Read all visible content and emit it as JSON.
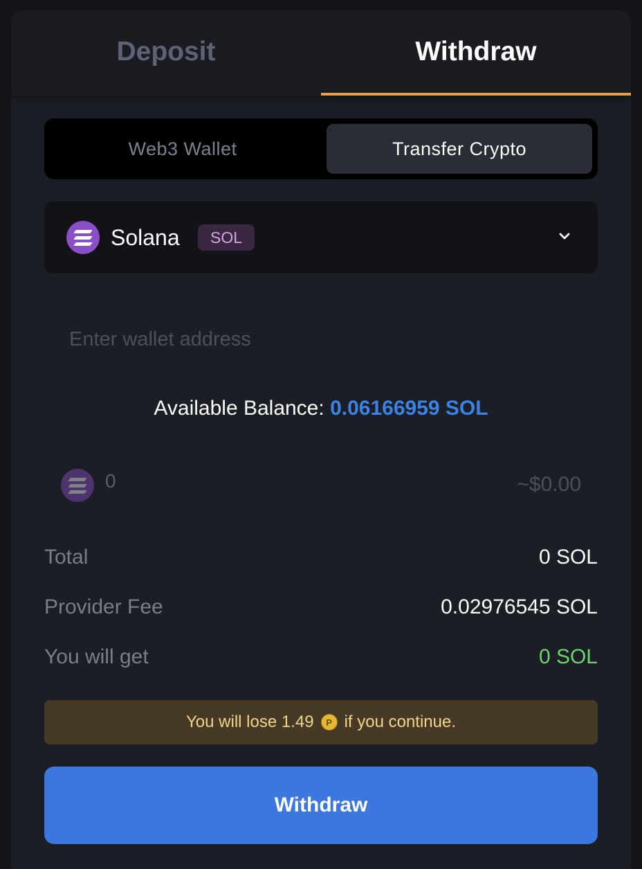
{
  "tabs": {
    "deposit_label": "Deposit",
    "withdraw_label": "Withdraw"
  },
  "method": {
    "web3_label": "Web3 Wallet",
    "transfer_label": "Transfer Crypto"
  },
  "coin": {
    "name": "Solana",
    "symbol": "SOL",
    "icon": "solana-icon",
    "dropdown_icon": "chevron-down-icon"
  },
  "address": {
    "value": "",
    "placeholder": "Enter wallet address"
  },
  "balance": {
    "label": "Available Balance:",
    "value": "0.06166959 SOL"
  },
  "amount": {
    "value": "0",
    "usd": "~$0.00"
  },
  "summary": {
    "total_label": "Total",
    "total_value": "0 SOL",
    "fee_label": "Provider Fee",
    "fee_value": "0.02976545 SOL",
    "get_label": "You will get",
    "get_value": "0 SOL"
  },
  "warning": {
    "prefix": "You will lose 1.49",
    "coin_icon": "points-coin-icon",
    "suffix": "if you continue."
  },
  "submit": {
    "label": "Withdraw"
  },
  "colors": {
    "accent_underline": "#e8a04c",
    "balance_value": "#3b82e6",
    "positive": "#6fd36f",
    "button": "#3b77dd",
    "warning_bg": "#463a27"
  }
}
